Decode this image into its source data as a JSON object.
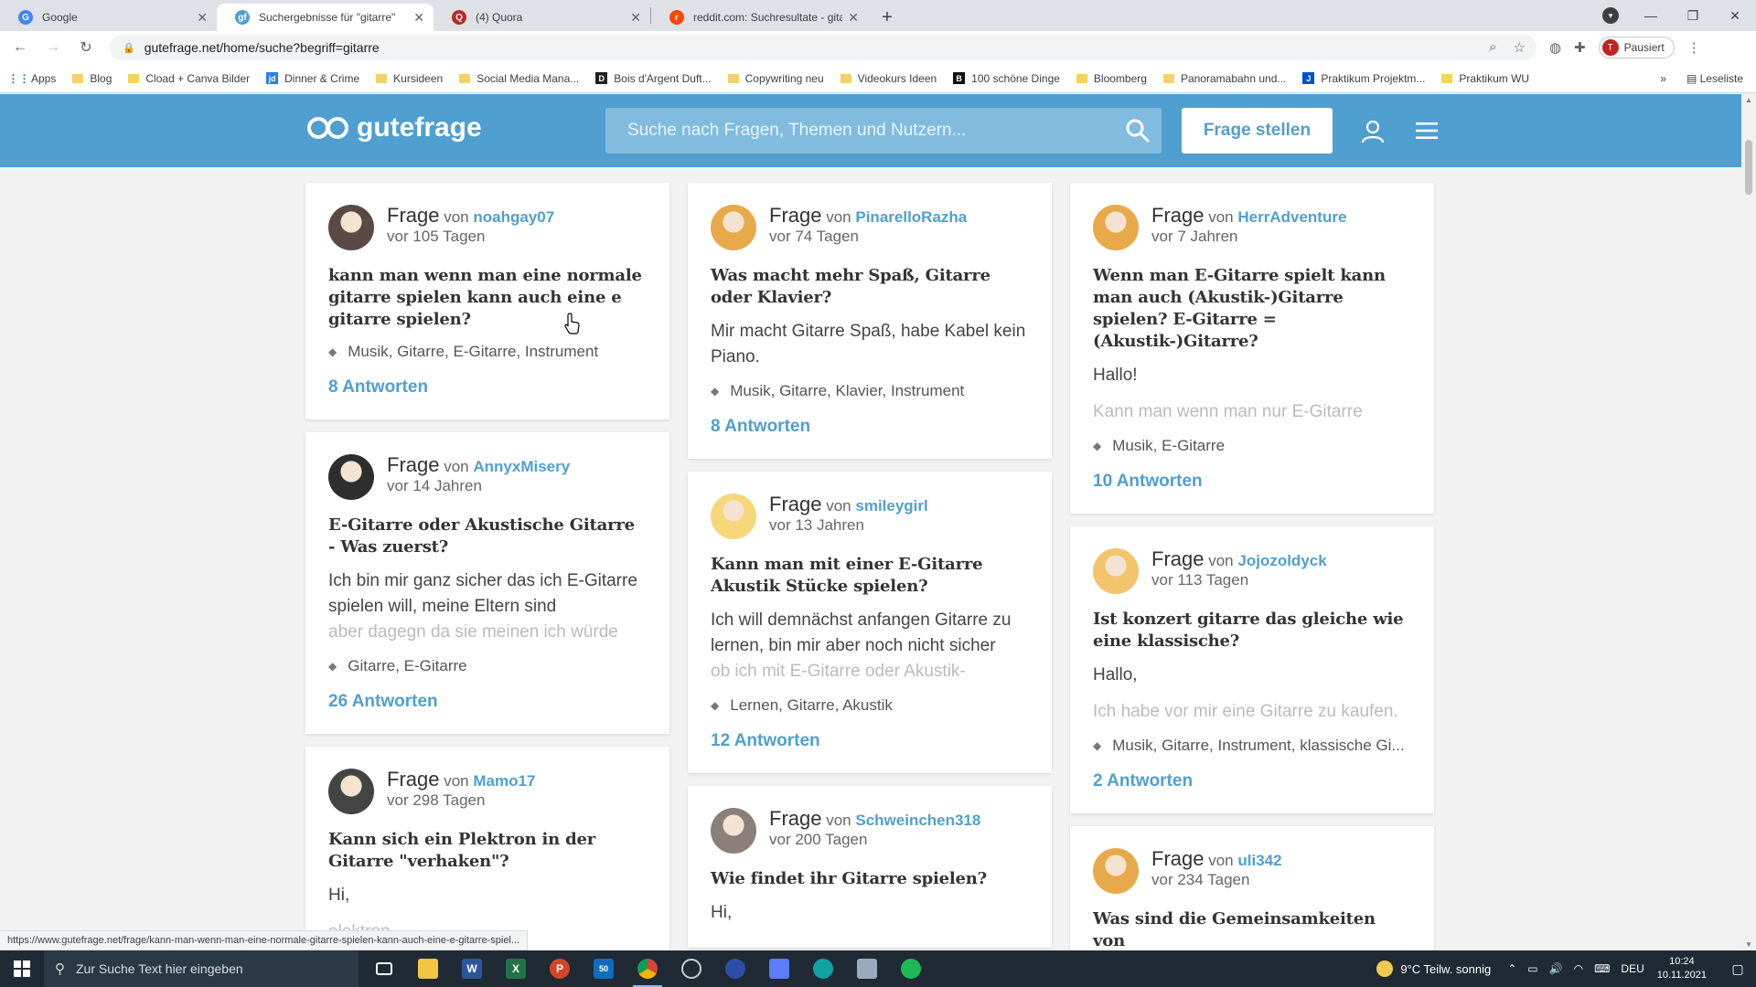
{
  "browser": {
    "tabs": [
      {
        "title": "Google",
        "favicon": "G",
        "color": "#4285f4"
      },
      {
        "title": "Suchergebnisse für \"gitarre\"",
        "favicon": "gf",
        "color": "#4f9fd0"
      },
      {
        "title": "(4) Quora",
        "favicon": "Q",
        "color": "#b92b27"
      },
      {
        "title": "reddit.com: Suchresultate - gitarre",
        "favicon": "r",
        "color": "#ff4500"
      }
    ],
    "url": "gutefrage.net/home/suche?begriff=gitarre",
    "profile_label": "Pausiert",
    "profile_initial": "T",
    "bookmarks": [
      {
        "label": "Apps",
        "kind": "grid"
      },
      {
        "label": "Blog",
        "kind": "folder"
      },
      {
        "label": "Cload + Canva Bilder",
        "kind": "folder"
      },
      {
        "label": "Dinner & Crime",
        "kind": "site",
        "mark": "jd",
        "color": "#2b7de9"
      },
      {
        "label": "Kursideen",
        "kind": "folder"
      },
      {
        "label": "Social Media Mana...",
        "kind": "folder"
      },
      {
        "label": "Bois d'Argent Duft...",
        "kind": "site",
        "mark": "D",
        "color": "#222"
      },
      {
        "label": "Copywriting neu",
        "kind": "folder"
      },
      {
        "label": "Videokurs Ideen",
        "kind": "folder"
      },
      {
        "label": "100 schöne Dinge",
        "kind": "site",
        "mark": "B",
        "color": "#111"
      },
      {
        "label": "Bloomberg",
        "kind": "folder"
      },
      {
        "label": "Panoramabahn und...",
        "kind": "folder"
      },
      {
        "label": "Praktikum Projektm...",
        "kind": "site",
        "mark": "J",
        "color": "#0052cc"
      },
      {
        "label": "Praktikum WU",
        "kind": "folder"
      }
    ],
    "more_bookmarks": "»",
    "reading_list": "Leseliste",
    "status_url": "https://www.gutefrage.net/frage/kann-man-wenn-man-eine-normale-gitarre-spielen-kann-auch-eine-e-gitarre-spiel..."
  },
  "site": {
    "logo": "gutefrage",
    "search_placeholder": "Suche nach Fragen, Themen und Nutzern...",
    "ask_button": "Frage stellen",
    "accent": "#4f9fd0"
  },
  "columns": [
    [
      {
        "frage": "Frage",
        "von": "von",
        "user": "noahgay07",
        "when": "vor 105 Tagen",
        "avatar": "#5a4a45",
        "title": "kann man wenn man eine normale gitarre spielen kann auch eine e gitarre spielen?",
        "body": [],
        "tags": "Musik, Gitarre, E-Gitarre, Instrument",
        "answers": "8 Antworten"
      },
      {
        "frage": "Frage",
        "von": "von",
        "user": "AnnyxMisery",
        "when": "vor 14 Jahren",
        "avatar": "#2e2e2e",
        "title": "E-Gitarre oder Akustische Gitarre - Was zuerst?",
        "body": [
          "Ich bin mir ganz sicher das ich E-Gitarre spielen will, meine Eltern sind"
        ],
        "body_fade": "aber dagegn da sie meinen ich würde",
        "tags": "Gitarre, E-Gitarre",
        "answers": "26 Antworten"
      },
      {
        "frage": "Frage",
        "von": "von",
        "user": "Mamo17",
        "when": "vor 298 Tagen",
        "avatar": "#444",
        "title": "Kann sich ein Plektron in der Gitarre \"verhaken\"?",
        "body": [
          "Hi,"
        ],
        "body_fade": "elektron",
        "tags": "",
        "answers": ""
      }
    ],
    [
      {
        "frage": "Frage",
        "von": "von",
        "user": "PinarelloRazha",
        "when": "vor 74 Tagen",
        "avatar": "#e8a94a",
        "title": "Was macht mehr Spaß, Gitarre oder Klavier?",
        "body": [
          "Mir macht Gitarre Spaß, habe Kabel kein Piano."
        ],
        "body_fade": "",
        "tags": "Musik, Gitarre, Klavier, Instrument",
        "answers": "8 Antworten"
      },
      {
        "frage": "Frage",
        "von": "von",
        "user": "smileygirl",
        "when": "vor 13 Jahren",
        "avatar": "#f6d77a",
        "title": "Kann man mit einer E-Gitarre Akustik Stücke spielen?",
        "body": [
          "Ich will demnächst anfangen Gitarre zu lernen, bin mir aber noch nicht sicher"
        ],
        "body_fade": "ob ich mit E-Gitarre oder Akustik-",
        "tags": "Lernen, Gitarre, Akustik",
        "answers": "12 Antworten"
      },
      {
        "frage": "Frage",
        "von": "von",
        "user": "Schweinchen318",
        "when": "vor 200 Tagen",
        "avatar": "#8a7f7a",
        "title": "Wie findet ihr Gitarre spielen?",
        "body": [
          "Hi,"
        ],
        "body_fade": "",
        "tags": "",
        "answers": ""
      }
    ],
    [
      {
        "frage": "Frage",
        "von": "von",
        "user": "HerrAdventure",
        "when": "vor 7 Jahren",
        "avatar": "#e8a94a",
        "title": "Wenn man E-Gitarre spielt kann man auch (Akustik-)Gitarre spielen? E-Gitarre = (Akustik-)Gitarre?",
        "body": [
          "Hallo!"
        ],
        "body_fade": "Kann man wenn man nur E-Gitarre",
        "tags": "Musik, E-Gitarre",
        "answers": "10 Antworten"
      },
      {
        "frage": "Frage",
        "von": "von",
        "user": "Jojozoldyck",
        "when": "vor 113 Tagen",
        "avatar": "#f2c46b",
        "title": "Ist konzert gitarre das gleiche wie eine klassische?",
        "body": [
          "Hallo,"
        ],
        "body_fade": "Ich habe vor mir eine Gitarre zu kaufen.",
        "tags": "Musik, Gitarre, Instrument, klassische Gi...",
        "answers": "2 Antworten"
      },
      {
        "frage": "Frage",
        "von": "von",
        "user": "uli342",
        "when": "vor 234 Tagen",
        "avatar": "#e8a94a",
        "title": "Was sind die Gemeinsamkeiten von",
        "body": [],
        "body_fade": "",
        "tags": "",
        "answers": ""
      }
    ]
  ],
  "taskbar": {
    "search_placeholder": "Zur Suche Text hier eingeben",
    "weather": "9°C  Teilw. sonnig",
    "lang": "DEU",
    "time": "10:24",
    "date": "10.11.2021",
    "mail_badge": "50"
  }
}
